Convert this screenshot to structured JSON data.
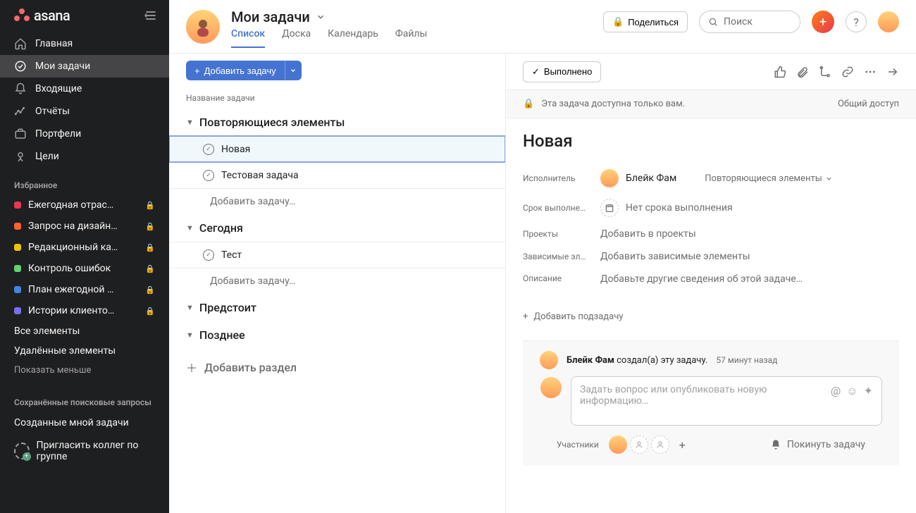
{
  "brand": "asana",
  "sidebar": {
    "nav": [
      {
        "label": "Главная"
      },
      {
        "label": "Мои задачи"
      },
      {
        "label": "Входящие"
      },
      {
        "label": "Отчёты"
      },
      {
        "label": "Портфели"
      },
      {
        "label": "Цели"
      }
    ],
    "favorites_title": "Избранное",
    "favorites": [
      {
        "label": "Ежегодная отрас…",
        "color": "#e8384f",
        "locked": true
      },
      {
        "label": "Запрос на дизайн…",
        "color": "#fd612c",
        "locked": true
      },
      {
        "label": "Редакционный ка…",
        "color": "#eec300",
        "locked": true
      },
      {
        "label": "Контроль ошибок",
        "color": "#62d26f",
        "locked": true
      },
      {
        "label": "План ежегодной …",
        "color": "#4186e0",
        "locked": true
      },
      {
        "label": "Истории клиенто…",
        "color": "#7a6ff0",
        "locked": true
      }
    ],
    "all_items": "Все элементы",
    "deleted": "Удалённые элементы",
    "show_less": "Показать меньше",
    "saved_searches_title": "Сохранённые поисковые запросы",
    "created_by_me": "Созданные мной задачи",
    "invite": "Пригласить коллег по группе"
  },
  "header": {
    "title": "Мои задачи",
    "tabs": [
      "Список",
      "Доска",
      "Календарь",
      "Файлы"
    ],
    "share": "Поделиться",
    "search_placeholder": "Поиск"
  },
  "list": {
    "add_task": "Добавить задачу",
    "column_header": "Название задачи",
    "sections": [
      {
        "name": "Повторяющиеся элементы",
        "tasks": [
          {
            "name": "Новая",
            "selected": true
          },
          {
            "name": "Тестовая задача",
            "selected": false
          }
        ],
        "add_placeholder": "Добавить задачу…"
      },
      {
        "name": "Сегодня",
        "tasks": [
          {
            "name": "Тест",
            "selected": false
          }
        ],
        "add_placeholder": "Добавить задачу…"
      },
      {
        "name": "Предстоит",
        "tasks": [],
        "add_placeholder": ""
      },
      {
        "name": "Позднее",
        "tasks": [],
        "add_placeholder": ""
      }
    ],
    "add_section": "Добавить раздел"
  },
  "detail": {
    "complete": "Выполнено",
    "banner_text": "Эта задача доступна только вам.",
    "banner_share": "Общий доступ",
    "title": "Новая",
    "fields": {
      "assignee_label": "Исполнитель",
      "assignee_value": "Блейк Фам",
      "section_value": "Повторяющиеся элементы",
      "due_label": "Срок выполне…",
      "due_value": "Нет срока выполнения",
      "projects_label": "Проекты",
      "projects_value": "Добавить в проекты",
      "deps_label": "Зависимые эл…",
      "deps_value": "Добавить зависимые элементы",
      "description_label": "Описание",
      "description_placeholder": "Добавьте другие сведения об этой задаче…"
    },
    "add_subtask": "Добавить подзадачу",
    "activity": {
      "actor": "Блейк Фам",
      "text": "создал(а) эту задачу.",
      "time": "57 минут назад"
    },
    "comment_placeholder": "Задать вопрос или опубликовать новую информацию…",
    "collaborators_label": "Участники",
    "leave": "Покинуть задачу"
  }
}
